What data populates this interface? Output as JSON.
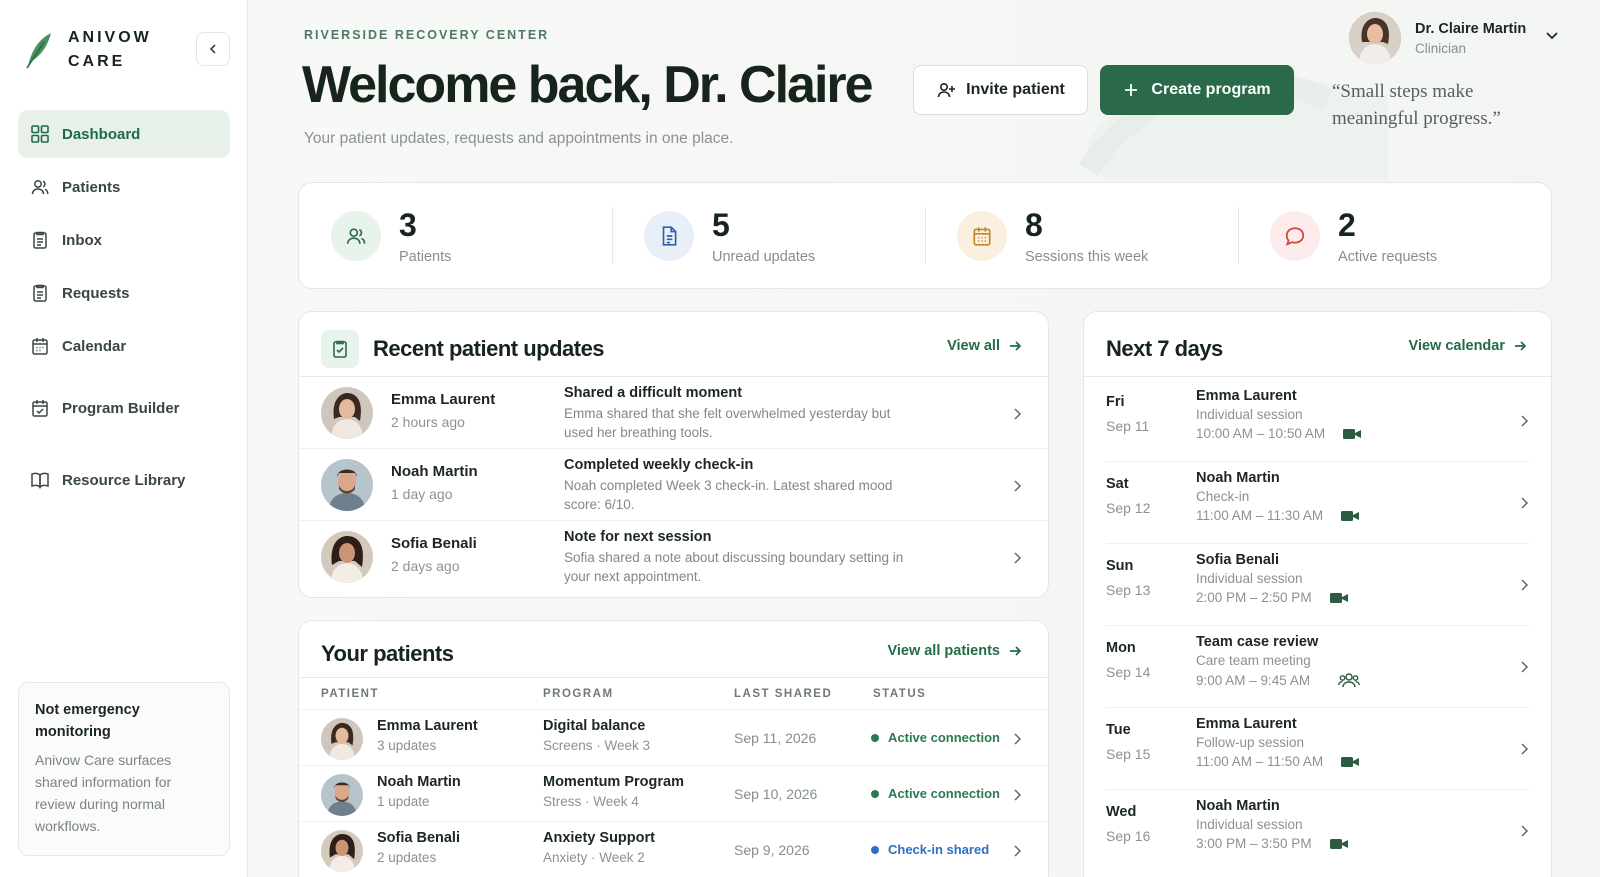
{
  "app": {
    "brand_line1": "ANIVOW",
    "brand_line2": "CARE",
    "accent": "#2a6a4b"
  },
  "sidebar": {
    "items": [
      {
        "label": "Dashboard",
        "icon": "grid-icon",
        "active": true
      },
      {
        "label": "Patients",
        "icon": "users-icon"
      },
      {
        "label": "Inbox",
        "icon": "inbox-icon"
      },
      {
        "label": "Requests",
        "icon": "clipboard-icon"
      },
      {
        "label": "Calendar",
        "icon": "calendar-icon"
      },
      {
        "label": "Program Builder",
        "icon": "calendar-check-icon"
      },
      {
        "label": "Resource Library",
        "icon": "book-icon"
      }
    ],
    "notice": {
      "title": "Not emergency monitoring",
      "body": "Anivow Care surfaces shared information for review during normal workflows."
    }
  },
  "header": {
    "eyebrow": "RIVERSIDE RECOVERY CENTER",
    "welcome": "Welcome back, Dr. Claire",
    "subtitle": "Your patient updates, requests and appointments in one place.",
    "invite_label": "Invite patient",
    "create_label": "Create program",
    "quote": "“Small steps make meaningful progress.”",
    "profile": {
      "name": "Dr. Claire Martin",
      "role": "Clinician"
    }
  },
  "stats": [
    {
      "value": "3",
      "label": "Patients",
      "icon": "users-icon",
      "color": "#e8f3ec"
    },
    {
      "value": "5",
      "label": "Unread updates",
      "icon": "document-icon",
      "color": "#e8eff8"
    },
    {
      "value": "8",
      "label": "Sessions this week",
      "icon": "calendar-icon",
      "color": "#fbf0dd"
    },
    {
      "value": "2",
      "label": "Active requests",
      "icon": "chat-bubble-icon",
      "color": "#fdeceb"
    }
  ],
  "updates": {
    "title": "Recent patient updates",
    "view_all": "View all",
    "rows": [
      {
        "name": "Emma Laurent",
        "time": "2 hours ago",
        "title": "Shared a difficult moment",
        "body": "Emma shared that she felt overwhelmed yesterday but used her breathing tools."
      },
      {
        "name": "Noah Martin",
        "time": "1 day ago",
        "title": "Completed weekly check-in",
        "body": "Noah completed Week 3 check-in. Latest shared mood score: 6/10."
      },
      {
        "name": "Sofia Benali",
        "time": "2 days ago",
        "title": "Note for next session",
        "body": "Sofia shared a note about discussing boundary setting in your next appointment."
      }
    ]
  },
  "patients": {
    "title": "Your patients",
    "view_all": "View all patients",
    "columns": [
      "PATIENT",
      "PROGRAM",
      "LAST SHARED",
      "STATUS"
    ],
    "rows": [
      {
        "name": "Emma Laurent",
        "updates": "3 updates",
        "program": "Digital balance",
        "program_sub": "Screens · Week 3",
        "last": "Sep 11, 2026",
        "status": "Active connection",
        "status_color": "#2a7a52"
      },
      {
        "name": "Noah Martin",
        "updates": "1 update",
        "program": "Momentum Program",
        "program_sub": "Stress · Week 4",
        "last": "Sep 10, 2026",
        "status": "Active connection",
        "status_color": "#2a7a52"
      },
      {
        "name": "Sofia Benali",
        "updates": "2 updates",
        "program": "Anxiety Support",
        "program_sub": "Anxiety · Week 2",
        "last": "Sep 9, 2026",
        "status": "Check-in shared",
        "status_color": "#2f6fc4"
      }
    ]
  },
  "next7": {
    "title": "Next 7 days",
    "view_calendar": "View calendar",
    "days": [
      {
        "day": "Fri",
        "date": "Sep 11",
        "title": "Emma Laurent",
        "sub": "Individual session",
        "time": "10:00 AM – 10:50 AM",
        "icon": "video-icon"
      },
      {
        "day": "Sat",
        "date": "Sep 12",
        "title": "Noah Martin",
        "sub": "Check-in",
        "time": "11:00 AM – 11:30 AM",
        "icon": "video-icon"
      },
      {
        "day": "Sun",
        "date": "Sep 13",
        "title": "Sofia Benali",
        "sub": "Individual session",
        "time": "2:00 PM – 2:50 PM",
        "icon": "video-icon"
      },
      {
        "day": "Mon",
        "date": "Sep 14",
        "title": "Team case review",
        "sub": "Care team meeting",
        "time": "9:00 AM – 9:45 AM",
        "icon": "group-icon"
      },
      {
        "day": "Tue",
        "date": "Sep 15",
        "title": "Emma Laurent",
        "sub": "Follow-up session",
        "time": "11:00 AM – 11:50 AM",
        "icon": "video-icon"
      },
      {
        "day": "Wed",
        "date": "Sep 16",
        "title": "Noah Martin",
        "sub": "Individual session",
        "time": "3:00 PM – 3:50 PM",
        "icon": "video-icon"
      }
    ]
  }
}
